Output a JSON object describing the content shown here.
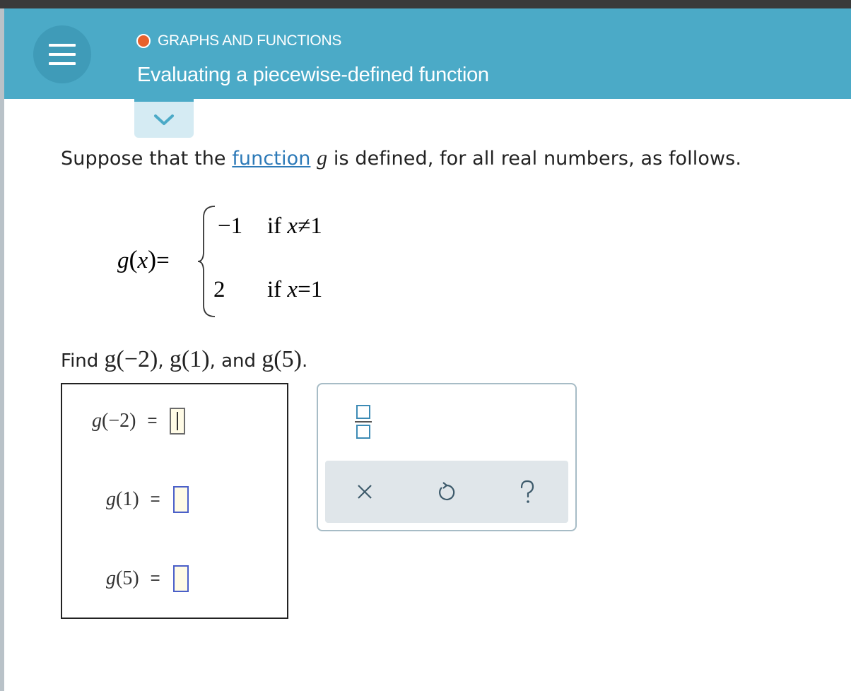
{
  "header": {
    "topic": "GRAPHS AND FUNCTIONS",
    "title": "Evaluating a piecewise-defined function",
    "accent_color": "#4baac7",
    "topic_dot_color": "#e8612c"
  },
  "problem": {
    "prompt_before": "Suppose that the",
    "prompt_link": "function",
    "prompt_var": "g",
    "prompt_after": "is defined, for all real numbers, as follows.",
    "piecewise": {
      "lhs_func": "g",
      "lhs_arg": "x",
      "cases": [
        {
          "value": "−1",
          "condition_prefix": "if",
          "condition_var": "x",
          "condition_rel": "≠",
          "condition_num": "1"
        },
        {
          "value": "2",
          "condition_prefix": "if",
          "condition_var": "x",
          "condition_rel": "=",
          "condition_num": "1"
        }
      ]
    },
    "find_prefix": "Find",
    "find_items": [
      "g(−2)",
      "g(1)",
      "g(5)"
    ],
    "find_and": "and"
  },
  "answers": [
    {
      "func": "g",
      "arg": "−2",
      "equals": "=",
      "value": ""
    },
    {
      "func": "g",
      "arg": "1",
      "equals": "=",
      "value": ""
    },
    {
      "func": "g",
      "arg": "5",
      "equals": "=",
      "value": ""
    }
  ],
  "toolbox": {
    "icons": [
      "fraction-icon",
      "clear-icon",
      "undo-icon",
      "help-icon"
    ],
    "clear_glyph": "×",
    "help_glyph": "?"
  }
}
